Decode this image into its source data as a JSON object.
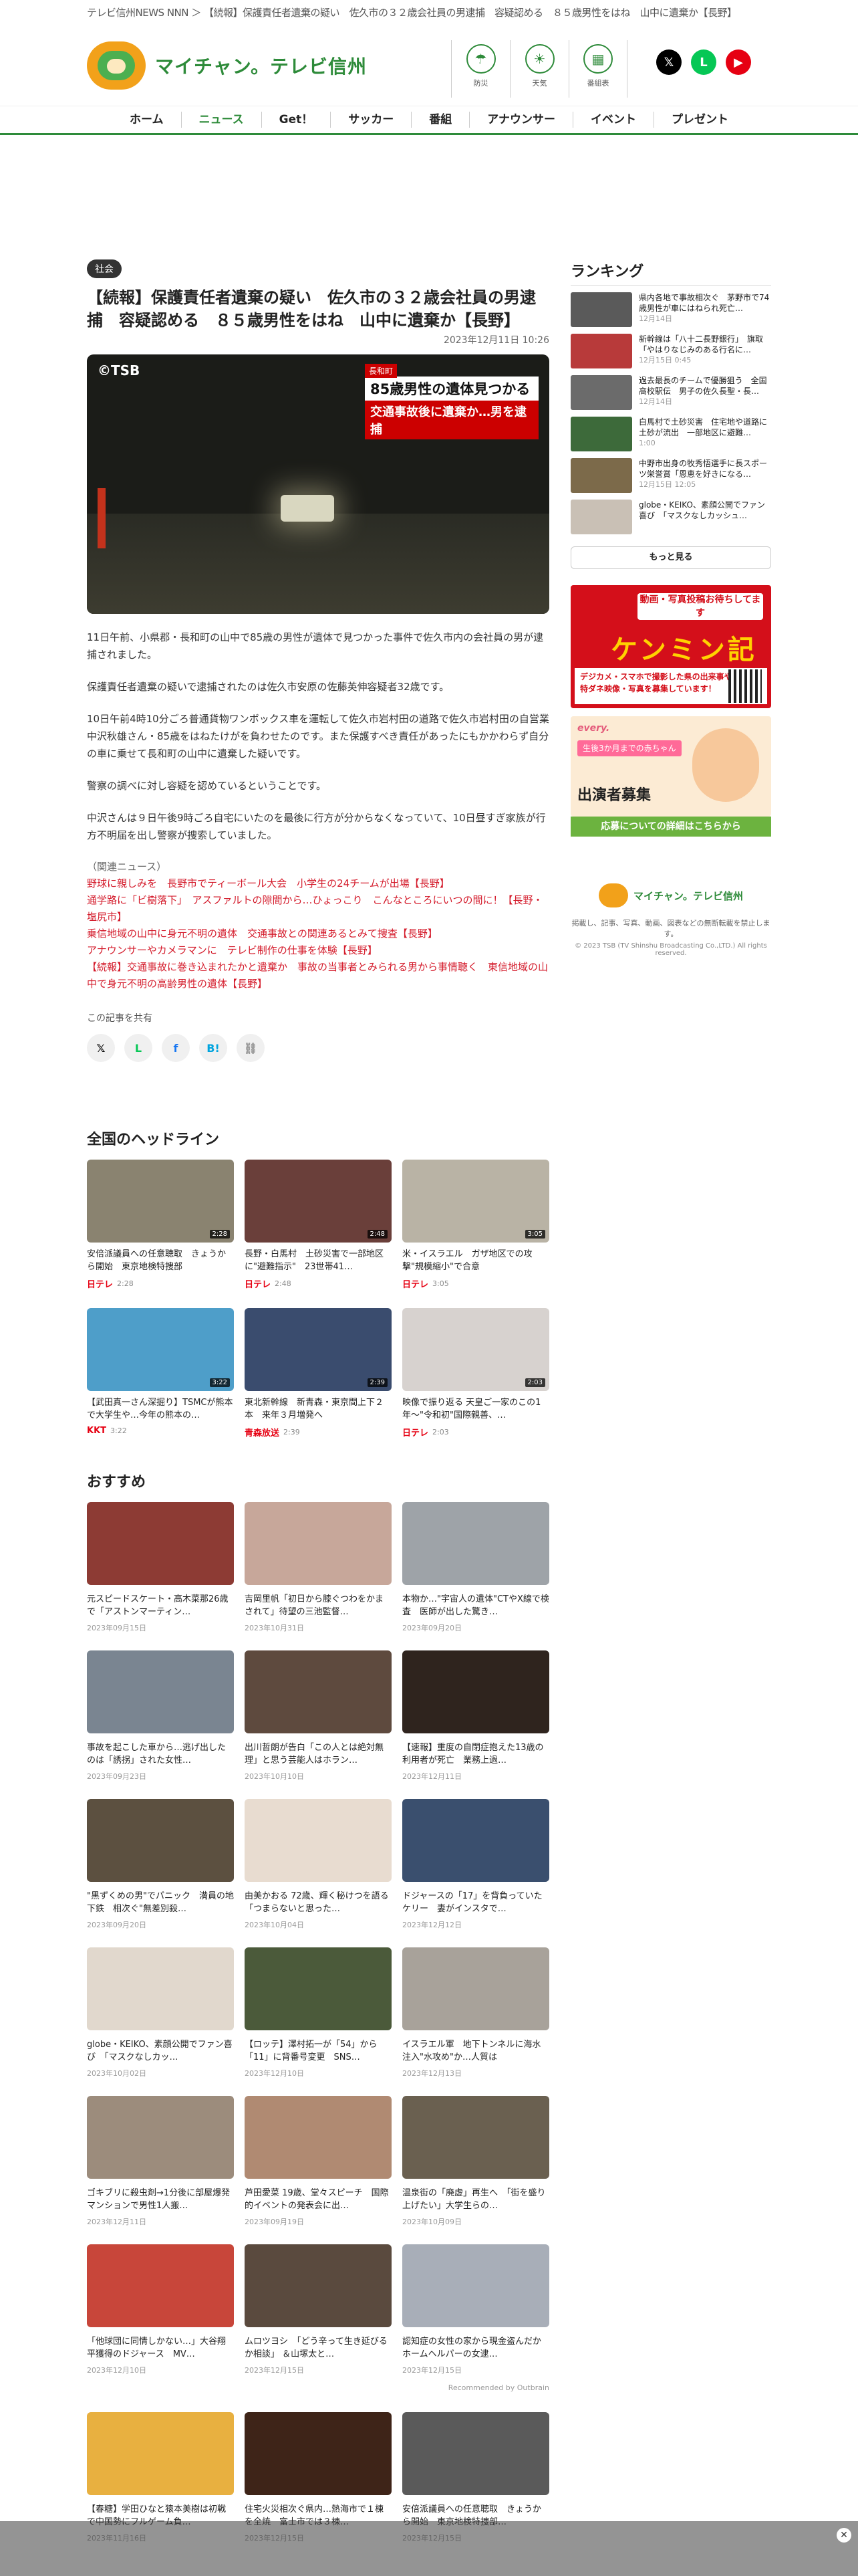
{
  "breadcrumb": "テレビ信州NEWS NNN ＞ 【続報】保護責任者遺棄の疑い　佐久市の３２歳会社員の男逮捕　容疑認める　８５歳男性をはね　山中に遺棄か【長野】",
  "logo": {
    "text": "マイチャン。テレビ信州"
  },
  "header_icons": [
    {
      "label": "防災",
      "glyph": "☂"
    },
    {
      "label": "天気",
      "glyph": "☀"
    },
    {
      "label": "番組表",
      "glyph": "▦"
    }
  ],
  "social": [
    {
      "name": "x",
      "glyph": "𝕏",
      "color": "#000000"
    },
    {
      "name": "line",
      "glyph": "L",
      "color": "#06c755"
    },
    {
      "name": "youtube",
      "glyph": "▶",
      "color": "#e60012"
    }
  ],
  "nav": [
    "ホーム",
    "ニュース",
    "Get！",
    "サッカー",
    "番組",
    "アナウンサー",
    "イベント",
    "プレゼント"
  ],
  "article": {
    "tag": "社会",
    "title": "【続報】保護責任者遺棄の疑い　佐久市の３２歳会社員の男逮捕　容疑認める　８５歳男性をはね　山中に遺棄か【長野】",
    "date": "2023年12月11日 10:26",
    "photo": {
      "watermark": "©TSB",
      "cap1": "長和町",
      "cap2": "85歳男性の遺体見つかる",
      "cap3": "交通事故後に遺棄か…男を逮捕"
    },
    "paragraphs": [
      "11日午前、小県郡・長和町の山中で85歳の男性が遺体で見つかった事件で佐久市内の会社員の男が逮捕されました。",
      "保護責任者遺棄の疑いで逮捕されたのは佐久市安原の佐藤英伸容疑者32歳です。",
      "10日午前4時10分ごろ普通貨物ワンボックス車を運転して佐久市岩村田の道路で佐久市岩村田の自営業中沢秋雄さん・85歳をはねたけがを負わせたのです。また保護すべき責任があったにもかかわらず自分の車に乗せて長和町の山中に遺棄した疑いです。",
      "警察の調べに対し容疑を認めているということです。",
      "中沢さんは９日午後9時ごろ自宅にいたのを最後に行方が分からなくなっていて、10日昼すぎ家族が行方不明届を出し警察が捜索していました。"
    ],
    "related_heading": "（関連ニュース）",
    "related": [
      "野球に親しみを　長野市でティーボール大会　小学生の24チームが出場【長野】",
      "通学路に「ビ樹落下」　アスファルトの隙間から…ひょっこり　こんなところにいつの間に！【長野・塩尻市】",
      "乗信地域の山中に身元不明の遺体　交通事故との関連あるとみて捜査【長野】",
      "アナウンサーやカメラマンに　テレビ制作の仕事を体験【長野】",
      "【続報】交通事故に巻き込まれたかと遺棄か　事故の当事者とみられる男から事情聴く　東信地域の山中で身元不明の高齢男性の遺体【長野】"
    ],
    "share_label": "この記事を共有",
    "share_buttons": [
      {
        "name": "x",
        "glyph": "𝕏",
        "color": "#000000"
      },
      {
        "name": "line",
        "glyph": "L",
        "color": "#06c755"
      },
      {
        "name": "facebook",
        "glyph": "f",
        "color": "#1877f2"
      },
      {
        "name": "hatena",
        "glyph": "B!",
        "color": "#00a4de"
      },
      {
        "name": "link",
        "glyph": "⛓",
        "color": "#999999"
      }
    ]
  },
  "sidebar": {
    "ranking_title": "ランキング",
    "ranking": [
      {
        "text": "県内各地で事故相次ぐ　茅野市で74歳男性が車にはねられ死亡…",
        "date": "12月14日",
        "color": "#5a5a5a"
      },
      {
        "text": "新幹線は「八十二長野銀行」　旗取「やはりなじみのある行名に…",
        "date": "12月15日 0:45",
        "color": "#b83a3a"
      },
      {
        "text": "過去最長のチームで優勝狙う　全国高校駅伝　男子の佐久長聖・長…",
        "date": "12月14日",
        "color": "#6b6b6b"
      },
      {
        "text": "白馬村で土砂災害　住宅地や道路に土砂が流出　一部地区に避難…",
        "date": "1:00",
        "color": "#3d6a3a"
      },
      {
        "text": "中野市出身の牧秀悟選手に長スポーツ栄誉賞「恩恵を好きになる…",
        "date": "12月15日 12:05",
        "color": "#7c6a4a"
      },
      {
        "text": "globe・KEIKO、素顔公開でファン喜び　「マスクなしカッシュ…",
        "date": "",
        "color": "#c9c0b5"
      }
    ],
    "more": "もっと見る",
    "banner1": {
      "top": "動画・写真投稿お待ちしてます",
      "main": "ケンミン記者",
      "sub": "デジカメ・スマホで撮影した県の出来事や話題・特ダネ映像・写真を募集しています！"
    },
    "banner2": {
      "brand": "every.",
      "badge": "生後3か月までの赤ちゃん",
      "main": "出演者募集",
      "bar": "応募についての詳細はこちらから"
    },
    "footer": {
      "logo": "マイチャン。テレビ信州",
      "note": "掲載し、記事、写真、動画、図表などの無断転載を禁止します。",
      "copyright": "© 2023 TSB (TV Shinshu Broadcasting Co.,LTD.) All rights reserved."
    }
  },
  "national": {
    "title": "全国のヘッドライン",
    "items": [
      {
        "title": "安倍派議員への任意聴取　きょうから開始　東京地検特捜部",
        "source": "日テレ",
        "dur": "2:28",
        "color": "#8a8370"
      },
      {
        "title": "長野・白馬村　土砂災害で一部地区に\"避難指示\"　23世帯41…",
        "source": "日テレ",
        "dur": "2:48",
        "color": "#6a3f3a"
      },
      {
        "title": "米・イスラエル　ガザ地区での攻撃\"規模縮小\"で合意",
        "source": "日テレ",
        "dur": "3:05",
        "color": "#b9b3a5"
      },
      {
        "title": "【武田真一さん深掘り】TSMCが熊本で大学生や…今年の熊本の…",
        "source": "KKT",
        "dur": "3:22",
        "color": "#4e9ec9"
      },
      {
        "title": "東北新幹線　新青森・東京間上下２本　来年３月増発へ",
        "source": "青森放送",
        "dur": "2:39",
        "color": "#3a4c6e"
      },
      {
        "title": "映像で振り返る 天皇ご一家のこの1年〜\"令和初\"国際親善、…",
        "source": "日テレ",
        "dur": "2:03",
        "color": "#d7d2cf"
      }
    ]
  },
  "recommend": {
    "title": "おすすめ",
    "items": [
      {
        "title": "元スピードスケート・高木菜那26歳で「アストンマーティン…",
        "date": "2023年09月15日",
        "color": "#8d3b34"
      },
      {
        "title": "吉岡里帆「初日から膝ぐつわをかまされて」待望の三池監督…",
        "date": "2023年10月31日",
        "color": "#c7a79a"
      },
      {
        "title": "本物か…\"宇宙人の遺体\"CTやX線で検査　医師が出した驚き…",
        "date": "2023年09月20日",
        "color": "#9ea3a8"
      },
      {
        "title": "事故を起こした車から…逃げ出したのは「誘拐」された女性…",
        "date": "2023年09月23日",
        "color": "#7a8591"
      },
      {
        "title": "出川哲朗が告白「この人とは絶対無理」と思う芸能人はホラン…",
        "date": "2023年10月10日",
        "color": "#5e4a3e"
      },
      {
        "title": "【速報】重度の自閉症抱えた13歳の利用者が死亡　業務上過…",
        "date": "2023年12月11日",
        "color": "#2f241e"
      },
      {
        "title": "\"黒ずくめの男\"でパニック　満員の地下鉄　相次ぐ\"無差別殺…",
        "date": "2023年09月20日",
        "color": "#5c5040"
      },
      {
        "title": "由美かおる 72歳、輝く秘けつを語る　「つまらないと思った…",
        "date": "2023年10月04日",
        "color": "#e8dcd0"
      },
      {
        "title": "ドジャースの「17」を背負っていたケリー　妻がインスタで…",
        "date": "2023年12月12日",
        "color": "#3a4f6e"
      },
      {
        "title": "globe・KEIKO、素顔公開でファン喜び　「マスクなしカッ…",
        "date": "2023年10月02日",
        "color": "#e1d8cd"
      },
      {
        "title": "【ロッテ】澤村拓一が「54」から「11」に背番号変更　SNS…",
        "date": "2023年12月10日",
        "color": "#4b5a3a"
      },
      {
        "title": "イスラエル軍　地下トンネルに海水注入\"水攻め\"か…人質は",
        "date": "2023年12月13日",
        "color": "#a8a29a"
      },
      {
        "title": "ゴキブリに殺虫剤→1分後に部屋爆発 マンションで男性1人搬…",
        "date": "2023年12月11日",
        "color": "#9c8c7c"
      },
      {
        "title": "芦田愛菜 19歳、堂々スピーチ　国際的イベントの発表会に出…",
        "date": "2023年09月19日",
        "color": "#b08a72"
      },
      {
        "title": "温泉街の「廃虚」再生へ　「街を盛り上げたい」大学生らの…",
        "date": "2023年10月09日",
        "color": "#6a6050"
      },
      {
        "title": "「他球団に同情しかない…」大谷翔平獲得のドジャース　MV…",
        "date": "2023年12月10日",
        "color": "#c8463a"
      },
      {
        "title": "ムロツヨシ　「どう辛って生き延びるか相談」 ＆山塚太と…",
        "date": "2023年12月15日",
        "color": "#5a4a3e"
      },
      {
        "title": "認知症の女性の家から現金盗んだか　ホームヘルパーの女逮…",
        "date": "2023年12月15日",
        "color": "#a8aeb8"
      },
      {
        "title": "【春糖】学田ひなと猿本美樹は初戦で中国勢にフルゲーム負…",
        "date": "2023年11月16日",
        "color": "#e8b040"
      },
      {
        "title": "住宅火災相次ぐ県内…熱海市で１棟を全焼　富士市では３棟…",
        "date": "2023年12月15日",
        "color": "#3e2418"
      },
      {
        "title": "安倍派議員への任意聴取　きょうから開始　東京地検特捜部…",
        "date": "2023年12月15日",
        "color": "#5a5a5a"
      }
    ],
    "outbrain": "Recommended by  Outbrain"
  }
}
